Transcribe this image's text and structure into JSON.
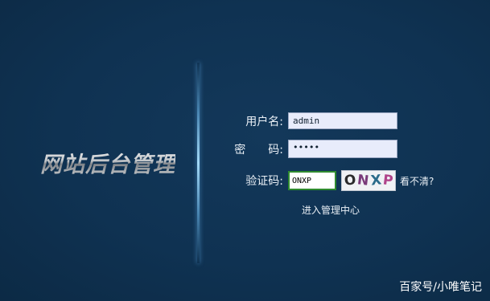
{
  "logo": {
    "text": "网站后台管理"
  },
  "form": {
    "username_label": "用户名:",
    "username_value": "admin",
    "password_label": "密　　码:",
    "password_value": "•••••",
    "captcha_label": "验证码:",
    "captcha_value": "ONXP",
    "captcha_image_text": "ONXP",
    "captcha_colors": [
      "#2b2b2b",
      "#7a3a7a",
      "#2a6b8a",
      "#b0448a"
    ],
    "cant_see_label": "看不清?",
    "submit_label": "进入管理中心"
  },
  "watermark": {
    "text": "百家号/小唯笔记"
  }
}
